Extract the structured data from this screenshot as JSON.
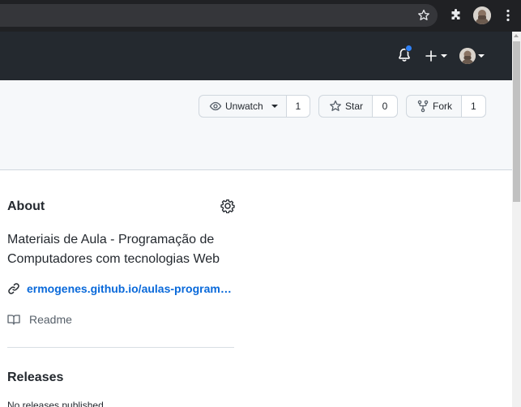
{
  "browser": {
    "icons": [
      "star-icon",
      "puzzle-icon",
      "avatar",
      "kebab-menu-icon"
    ],
    "toolbar_color": "#202124",
    "omnibox_color": "#35363a"
  },
  "header": {
    "icons": [
      "bell-icon",
      "plus-icon",
      "avatar"
    ],
    "notification_dot_color": "#2f81f7",
    "background": "#24292f"
  },
  "repo_actions": {
    "watch": {
      "label": "Unwatch",
      "count": "1",
      "icon": "eye-icon"
    },
    "star": {
      "label": "Star",
      "count": "0",
      "icon": "star-icon"
    },
    "fork": {
      "label": "Fork",
      "count": "1",
      "icon": "fork-icon"
    }
  },
  "about": {
    "title": "About",
    "description": "Materiais de Aula - Programação de Computadores com tecnologias Web",
    "link": "ermogenes.github.io/aulas-programacao-computadores-web",
    "readme": "Readme"
  },
  "releases": {
    "title": "Releases",
    "empty_text": "No releases published"
  },
  "colors": {
    "link": "#0969da",
    "text": "#24292f",
    "muted": "#57606a",
    "border": "#d0d7de"
  }
}
